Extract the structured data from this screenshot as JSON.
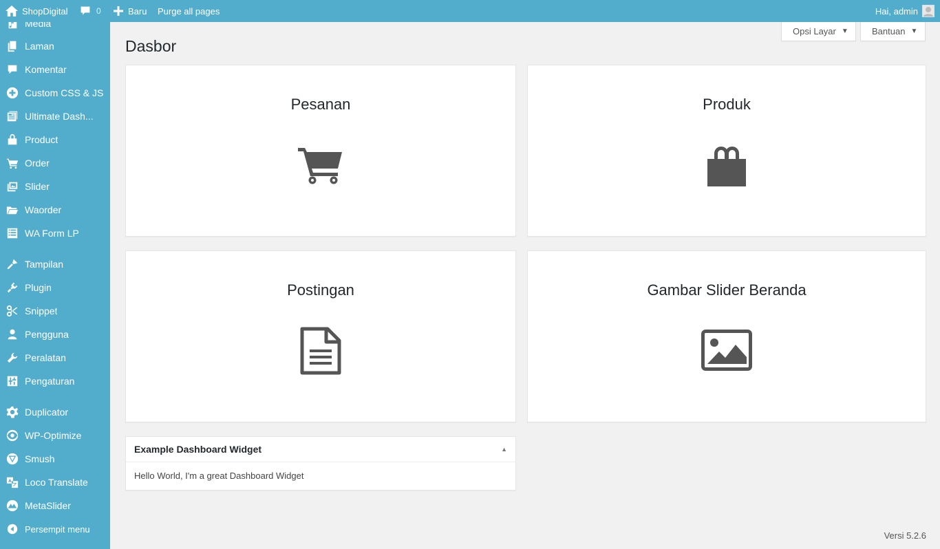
{
  "adminbar": {
    "site_name": "ShopDigital",
    "comments_count": "0",
    "new_label": "Baru",
    "purge_label": "Purge all pages",
    "greeting": "Hai, admin"
  },
  "sidebar": {
    "items": [
      {
        "label": "Media",
        "icon": "media-icon"
      },
      {
        "label": "Laman",
        "icon": "page-icon"
      },
      {
        "label": "Komentar",
        "icon": "comment-icon"
      },
      {
        "label": "Custom CSS & JS",
        "icon": "plus-circle-icon"
      },
      {
        "label": "Ultimate Dash...",
        "icon": "dashboard-icon"
      },
      {
        "label": "Product",
        "icon": "shopping-bag-icon"
      },
      {
        "label": "Order",
        "icon": "cart-icon"
      },
      {
        "label": "Slider",
        "icon": "slides-icon"
      },
      {
        "label": "Waorder",
        "icon": "folder-icon"
      },
      {
        "label": "WA Form LP",
        "icon": "list-icon"
      },
      {
        "label": "Tampilan",
        "icon": "brush-icon"
      },
      {
        "label": "Plugin",
        "icon": "plugin-icon"
      },
      {
        "label": "Snippet",
        "icon": "scissors-icon"
      },
      {
        "label": "Pengguna",
        "icon": "user-icon"
      },
      {
        "label": "Peralatan",
        "icon": "wrench-icon"
      },
      {
        "label": "Pengaturan",
        "icon": "settings-icon"
      },
      {
        "label": "Duplicator",
        "icon": "gear-icon"
      },
      {
        "label": "WP-Optimize",
        "icon": "optimize-icon"
      },
      {
        "label": "Smush",
        "icon": "smush-icon"
      },
      {
        "label": "Loco Translate",
        "icon": "translate-icon"
      },
      {
        "label": "MetaSlider",
        "icon": "metaslider-icon"
      },
      {
        "label": "Persempit menu",
        "icon": "collapse-icon"
      }
    ]
  },
  "header": {
    "title": "Dasbor",
    "screen_options": "Opsi Layar",
    "help": "Bantuan"
  },
  "cards": {
    "pesanan": {
      "title": "Pesanan",
      "icon": "cart-icon"
    },
    "produk": {
      "title": "Produk",
      "icon": "shopping-bag-icon"
    },
    "postingan": {
      "title": "Postingan",
      "icon": "document-icon"
    },
    "slider": {
      "title": "Gambar Slider Beranda",
      "icon": "image-icon"
    }
  },
  "widget": {
    "title": "Example Dashboard Widget",
    "body": "Hello World, I'm a great Dashboard Widget"
  },
  "footer": {
    "version": "Versi 5.2.6"
  },
  "colors": {
    "admin_accent": "#52accc",
    "background": "#f1f1f1",
    "icon_gray": "#555555"
  }
}
